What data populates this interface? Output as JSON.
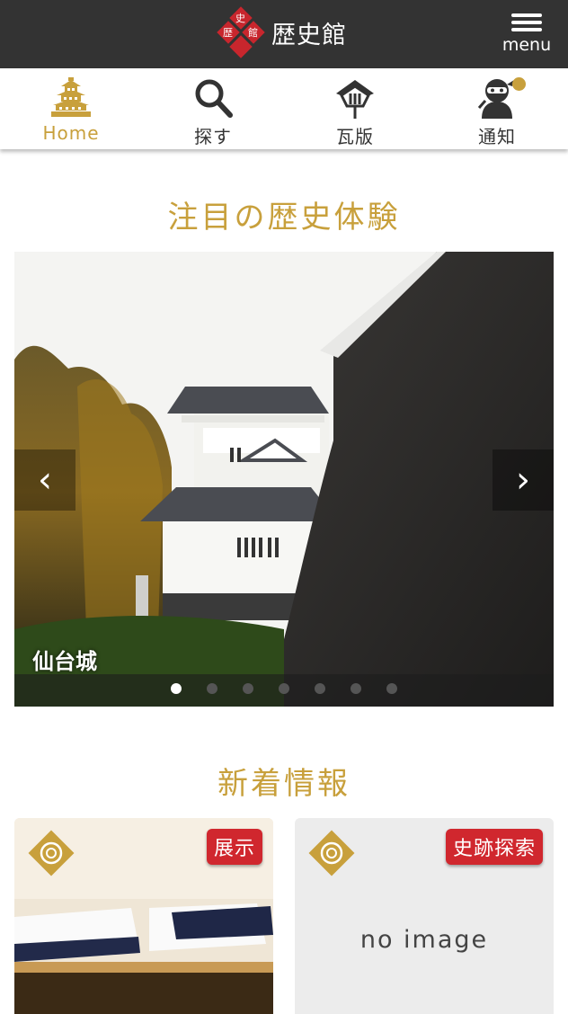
{
  "header": {
    "logo_chars": [
      "史",
      "歴",
      "館"
    ],
    "site_title": "歴史館",
    "menu_label": "menu"
  },
  "tabs": [
    {
      "label": "Home",
      "icon": "castle-icon",
      "active": true
    },
    {
      "label": "探す",
      "icon": "search-icon",
      "active": false
    },
    {
      "label": "瓦版",
      "icon": "kawaraban-icon",
      "active": false
    },
    {
      "label": "通知",
      "icon": "ninja-icon",
      "active": false,
      "has_notification": true
    }
  ],
  "featured": {
    "heading": "注目の歴史体験",
    "slide_caption": "仙台城",
    "slide_count": 7,
    "active_slide": 1
  },
  "news": {
    "heading": "新着情報",
    "cards": [
      {
        "badge": "展示"
      },
      {
        "badge": "史跡探索",
        "placeholder": "no image"
      }
    ]
  },
  "colors": {
    "header_bg": "#333333",
    "accent_gold": "#c8a03c",
    "badge_red": "#d0272e",
    "logo_red": "#c8262d"
  }
}
